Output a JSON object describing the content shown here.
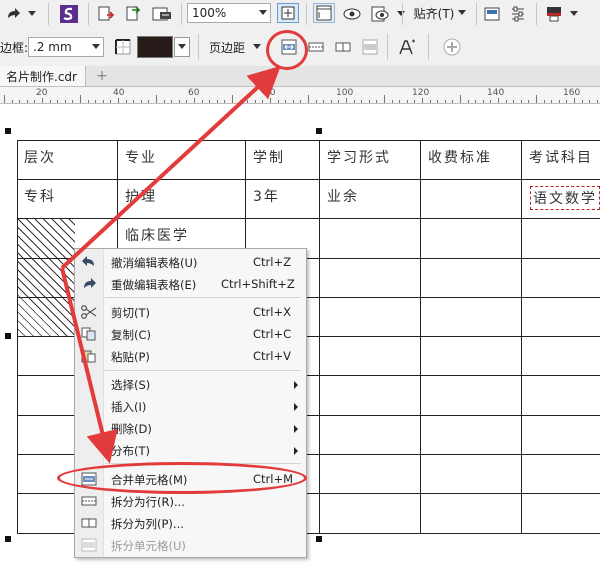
{
  "toolbar1": {
    "zoom_value": "100%",
    "snap_label": "贴齐(T)"
  },
  "toolbar2": {
    "border_label": "边框:",
    "border_width": ".2 mm",
    "page_margin_label": "页边距"
  },
  "tabs": {
    "doc_title": "名片制作.cdr",
    "add_tab": "+"
  },
  "ruler": {
    "labels": [
      "20",
      "40",
      "60",
      "80",
      "100",
      "120",
      "140",
      "160"
    ]
  },
  "table": {
    "header": [
      "层次",
      "专业",
      "学制",
      "学习形式",
      "收费标准",
      "考试科目"
    ],
    "row1": [
      "专科",
      "护理",
      "3年",
      "业余",
      "",
      "语文数学"
    ],
    "row2_major": "临床医学"
  },
  "context_menu": {
    "items": [
      {
        "label": "撤消编辑表格(U)",
        "shortcut": "Ctrl+Z",
        "icon": "undo-icon"
      },
      {
        "label": "重做编辑表格(E)",
        "shortcut": "Ctrl+Shift+Z",
        "icon": "redo-icon"
      },
      {
        "label": "剪切(T)",
        "shortcut": "Ctrl+X",
        "icon": "scissors-icon"
      },
      {
        "label": "复制(C)",
        "shortcut": "Ctrl+C",
        "icon": "copy-icon"
      },
      {
        "label": "粘贴(P)",
        "shortcut": "Ctrl+V",
        "icon": "paste-icon"
      },
      {
        "label": "选择(S)",
        "shortcut": "",
        "icon": ""
      },
      {
        "label": "插入(I)",
        "shortcut": "",
        "icon": ""
      },
      {
        "label": "删除(D)",
        "shortcut": "",
        "icon": ""
      },
      {
        "label": "分布(T)",
        "shortcut": "",
        "icon": ""
      },
      {
        "label": "合并单元格(M)",
        "shortcut": "Ctrl+M",
        "icon": "merge-cells-icon"
      },
      {
        "label": "拆分为行(R)...",
        "shortcut": "",
        "icon": "split-rows-icon"
      },
      {
        "label": "拆分为列(P)...",
        "shortcut": "",
        "icon": "split-columns-icon"
      },
      {
        "label": "拆分单元格(U)",
        "shortcut": "",
        "icon": "split-cells-icon"
      }
    ]
  },
  "colors": {
    "annotation_red": "#e23b3b",
    "fill_swatch": "#2a1b1b"
  }
}
